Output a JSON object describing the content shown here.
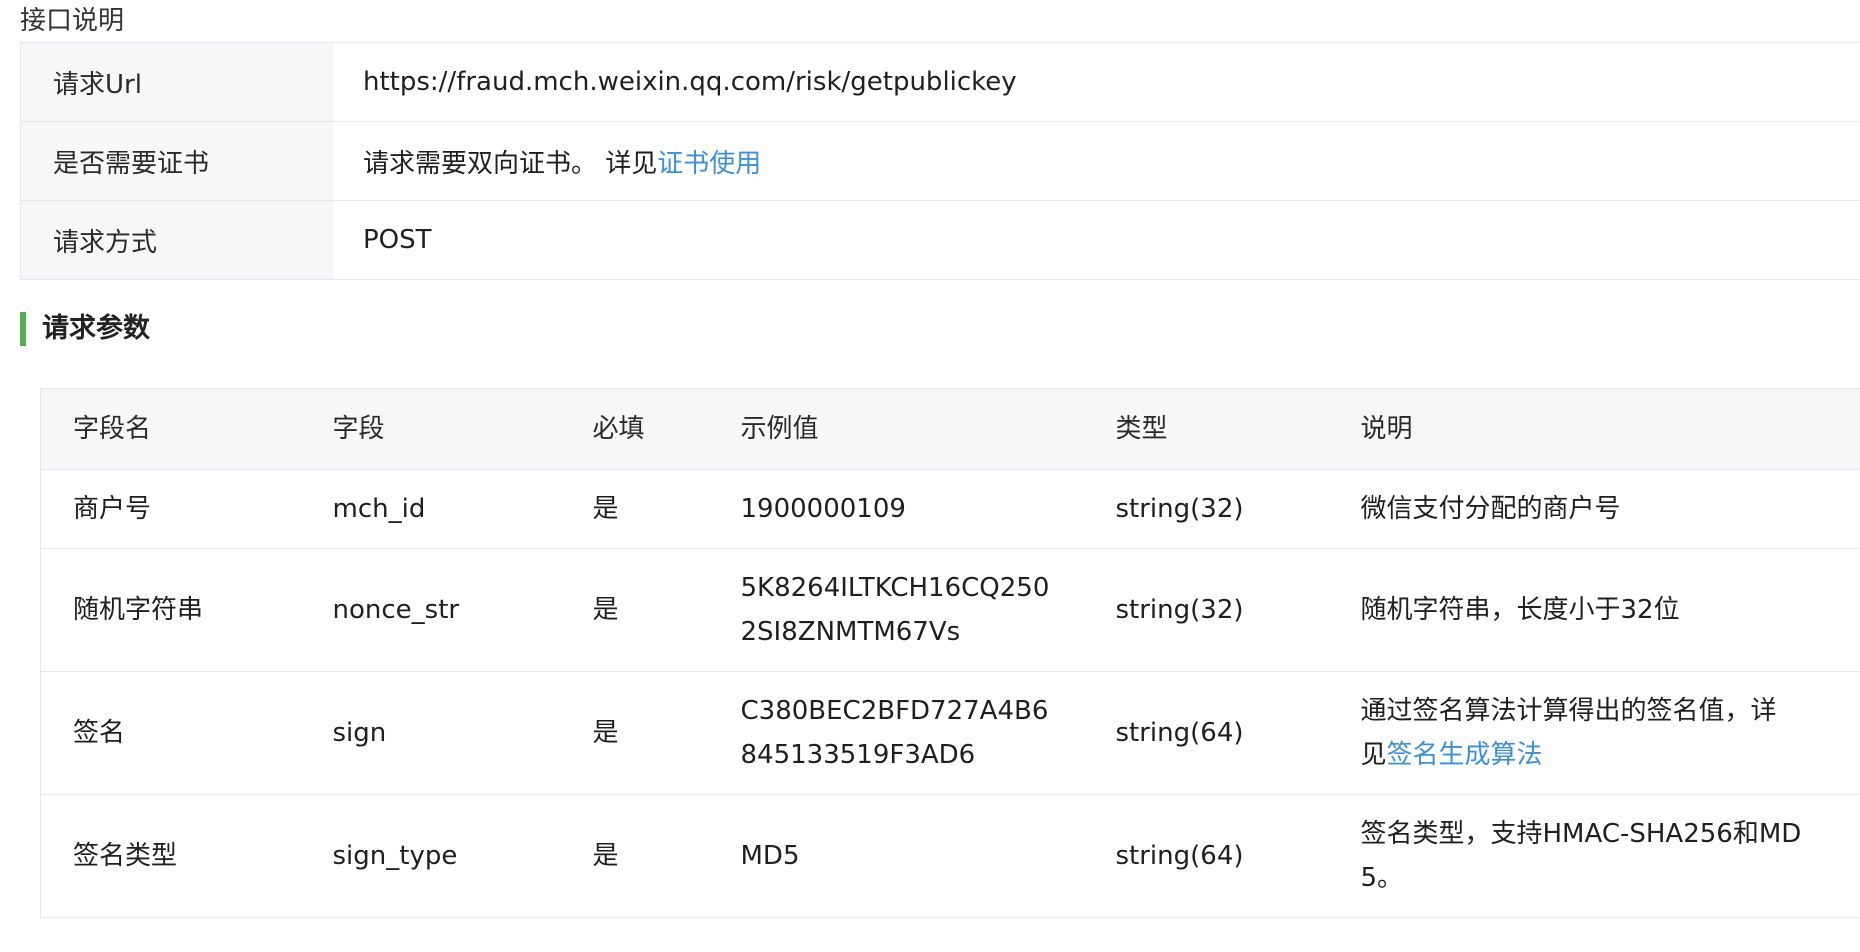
{
  "section_label": "接口说明",
  "info": {
    "rows": [
      {
        "key": "请求Url",
        "value": "https://fraud.mch.weixin.qq.com/risk/getpublickey"
      },
      {
        "key": "是否需要证书",
        "value": "请求需要双向证书。 详见",
        "link": "证书使用"
      },
      {
        "key": "请求方式",
        "value": "POST"
      }
    ]
  },
  "params": {
    "heading": "请求参数",
    "headers": [
      "字段名",
      "字段",
      "必填",
      "示例值",
      "类型",
      "说明"
    ],
    "rows": [
      {
        "name": "商户号",
        "field": "mch_id",
        "required": "是",
        "example_1": "1900000109",
        "example_2": "",
        "type": "string(32)",
        "desc_1": "微信支付分配的商户号",
        "desc_2": "",
        "desc_link": ""
      },
      {
        "name": "随机字符串",
        "field": "nonce_str",
        "required": "是",
        "example_1": "5K8264ILTKCH16CQ250",
        "example_2": "2SI8ZNMTM67Vs",
        "type": "string(32)",
        "desc_1": "随机字符串，长度小于32位",
        "desc_2": "",
        "desc_link": ""
      },
      {
        "name": "签名",
        "field": "sign",
        "required": "是",
        "example_1": "C380BEC2BFD727A4B6",
        "example_2": "845133519F3AD6",
        "type": "string(64)",
        "desc_1": "通过签名算法计算得出的签名值，详",
        "desc_2": "见",
        "desc_link": "签名生成算法"
      },
      {
        "name": "签名类型",
        "field": "sign_type",
        "required": "是",
        "example_1": "MD5",
        "example_2": "",
        "type": "string(64)",
        "desc_1": "签名类型，支持HMAC-SHA256和MD",
        "desc_2": "5。",
        "desc_link": ""
      }
    ]
  },
  "colors": {
    "link": "#3b8fe0",
    "accent_bar": "#4caf50",
    "header_bg": "#f6f7f9",
    "border": "#e5e7eb"
  }
}
